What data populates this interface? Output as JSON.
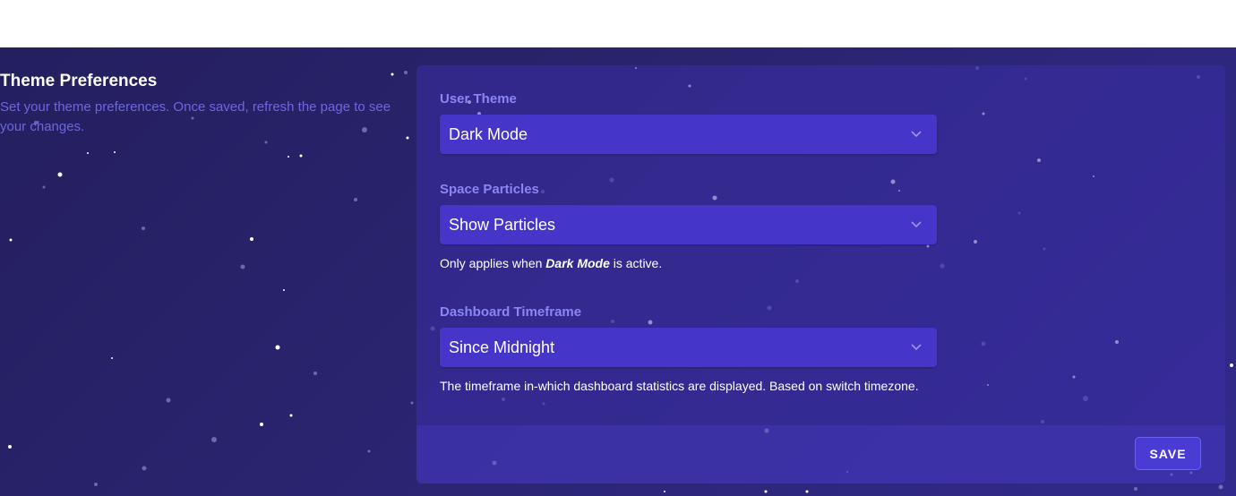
{
  "section": {
    "title": "Theme Preferences",
    "description": "Set your theme preferences. Once saved, refresh the page to see your changes."
  },
  "fields": {
    "user_theme": {
      "label": "User Theme",
      "value": "Dark Mode"
    },
    "space_particles": {
      "label": "Space Particles",
      "value": "Show Particles",
      "hint_prefix": "Only applies when ",
      "hint_emphasis": "Dark Mode",
      "hint_suffix": " is active."
    },
    "dashboard_timeframe": {
      "label": "Dashboard Timeframe",
      "value": "Since Midnight",
      "hint": "The timeframe in-which dashboard statistics are displayed. Based on switch timezone."
    }
  },
  "actions": {
    "save_label": "SAVE"
  },
  "colors": {
    "background": "#2a2470",
    "card": "#3a2ea5",
    "select": "#4535c8",
    "accent_text": "#8b86f3",
    "description_text": "#6d66e4",
    "button_border": "#6a63f0"
  },
  "icons": {
    "dropdown": "chevron-down-icon"
  }
}
